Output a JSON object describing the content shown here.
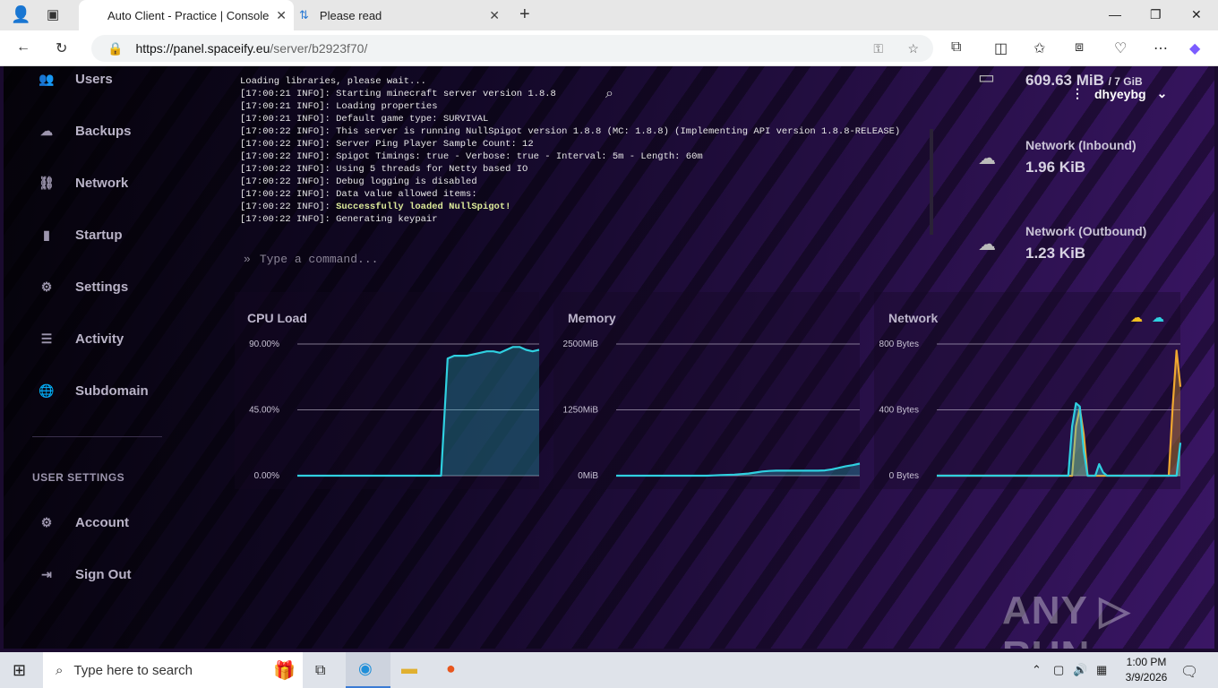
{
  "browser": {
    "tabs": [
      {
        "title": "Auto Client - Practice | Console",
        "active": true
      },
      {
        "title": "Please read",
        "active": false
      }
    ],
    "new_tab": "+",
    "url_host": "https://panel.spaceify.eu",
    "url_path": "/server/b2923f70/",
    "window_controls": [
      "—",
      "❐",
      "✕"
    ]
  },
  "sidebar": {
    "items": [
      {
        "label": "Users",
        "icon": "users-icon",
        "glyph": "👥"
      },
      {
        "label": "Backups",
        "icon": "cloud-icon",
        "glyph": "☁"
      },
      {
        "label": "Network",
        "icon": "network-icon",
        "glyph": "⛓"
      },
      {
        "label": "Startup",
        "icon": "chart-bar-icon",
        "glyph": "▮"
      },
      {
        "label": "Settings",
        "icon": "gears-icon",
        "glyph": "⚙"
      },
      {
        "label": "Activity",
        "icon": "list-icon",
        "glyph": "☰"
      },
      {
        "label": "Subdomain",
        "icon": "globe-icon",
        "glyph": "🌐"
      }
    ],
    "user_settings_heading": "USER SETTINGS",
    "user_items": [
      {
        "label": "Account",
        "icon": "gears-icon",
        "glyph": "⚙"
      },
      {
        "label": "Sign Out",
        "icon": "sign-out-icon",
        "glyph": "⇥"
      }
    ]
  },
  "console": {
    "lines": [
      {
        "text": "Loading libraries, please wait...",
        "ok": false
      },
      {
        "text": "[17:00:21 INFO]: Starting minecraft server version 1.8.8",
        "ok": false
      },
      {
        "text": "[17:00:21 INFO]: Loading properties",
        "ok": false
      },
      {
        "text": "[17:00:21 INFO]: Default game type: SURVIVAL",
        "ok": false
      },
      {
        "text": "[17:00:22 INFO]: This server is running NullSpigot version 1.8.8 (MC: 1.8.8) (Implementing API version 1.8.8-RELEASE)",
        "ok": false
      },
      {
        "text": "[17:00:22 INFO]: Server Ping Player Sample Count: 12",
        "ok": false
      },
      {
        "text": "[17:00:22 INFO]: Spigot Timings: true - Verbose: true - Interval: 5m - Length: 60m",
        "ok": false
      },
      {
        "text": "[17:00:22 INFO]: Using 5 threads for Netty based IO",
        "ok": false
      },
      {
        "text": "[17:00:22 INFO]: Debug logging is disabled",
        "ok": false
      },
      {
        "text": "[17:00:22 INFO]: Data value allowed items:",
        "ok": false
      },
      {
        "prefix": "[17:00:22 INFO]: ",
        "text": "Successfully loaded NullSpigot!",
        "ok": true
      },
      {
        "text": "[17:00:22 INFO]: Generating keypair",
        "ok": false
      }
    ],
    "command_placeholder": "Type a command..."
  },
  "stats": {
    "memory_value": "609.63 MiB",
    "memory_limit": "/ 7 GiB",
    "inbound_label": "Network (Inbound)",
    "inbound_value": "1.96 KiB",
    "outbound_label": "Network (Outbound)",
    "outbound_value": "1.23 KiB"
  },
  "user": {
    "name": "dhyeybg"
  },
  "colors": {
    "cyan": "#2fd0e0",
    "orange": "#f0a830",
    "grid": "#d8d2e4"
  },
  "chart_data": [
    {
      "type": "area",
      "title": "CPU Load",
      "y_ticks": [
        "90.00%",
        "45.00%",
        "0.00%"
      ],
      "ylim": [
        0,
        90
      ],
      "series": [
        {
          "color": "#2fd0e0",
          "values": [
            0,
            0,
            0,
            0,
            0,
            0,
            0,
            0,
            0,
            0,
            0,
            0,
            0,
            0,
            0,
            0,
            0,
            0,
            0,
            0,
            0,
            0,
            0,
            80,
            82,
            82,
            82,
            83,
            84,
            85,
            85,
            84,
            86,
            88,
            88,
            86,
            85,
            86
          ]
        }
      ]
    },
    {
      "type": "area",
      "title": "Memory",
      "y_ticks": [
        "2500MiB",
        "1250MiB",
        "0MiB"
      ],
      "ylim": [
        0,
        2500
      ],
      "series": [
        {
          "color": "#2fd0e0",
          "values": [
            0,
            0,
            0,
            0,
            0,
            0,
            0,
            0,
            0,
            0,
            0,
            0,
            0,
            0,
            5,
            10,
            15,
            20,
            30,
            40,
            60,
            80,
            90,
            95,
            95,
            95,
            95,
            95,
            95,
            95,
            100,
            120,
            150,
            180,
            200,
            230
          ]
        }
      ]
    },
    {
      "type": "line",
      "title": "Network",
      "y_ticks": [
        "800 Bytes",
        "400 Bytes",
        "0 Bytes"
      ],
      "ylim": [
        0,
        800
      ],
      "legend_icons": [
        "upload-icon",
        "download-icon"
      ],
      "series": [
        {
          "color": "#f0a830",
          "values": [
            0,
            0,
            0,
            0,
            0,
            0,
            0,
            0,
            0,
            0,
            0,
            0,
            0,
            0,
            0,
            0,
            0,
            0,
            0,
            0,
            0,
            0,
            0,
            0,
            0,
            0,
            0,
            0,
            0,
            0,
            0,
            0,
            0,
            0,
            0,
            0,
            300,
            410,
            250,
            0,
            0,
            0,
            0,
            0,
            0,
            0,
            0,
            0,
            0,
            0,
            0,
            0,
            0,
            0,
            0,
            0,
            0,
            0,
            0,
            0,
            0,
            420,
            760,
            540
          ]
        },
        {
          "color": "#2fd0e0",
          "values": [
            0,
            0,
            0,
            0,
            0,
            0,
            0,
            0,
            0,
            0,
            0,
            0,
            0,
            0,
            0,
            0,
            0,
            0,
            0,
            0,
            0,
            0,
            0,
            0,
            0,
            0,
            0,
            0,
            0,
            0,
            0,
            0,
            0,
            0,
            0,
            300,
            440,
            420,
            150,
            0,
            0,
            0,
            70,
            20,
            0,
            0,
            0,
            0,
            0,
            0,
            0,
            0,
            0,
            0,
            0,
            0,
            0,
            0,
            0,
            0,
            0,
            0,
            0,
            200
          ]
        }
      ]
    }
  ],
  "watermark": "ANY ▷ RUN",
  "taskbar": {
    "search_placeholder": "Type here to search",
    "time": "1:00 PM",
    "date": "3/9/2026"
  }
}
